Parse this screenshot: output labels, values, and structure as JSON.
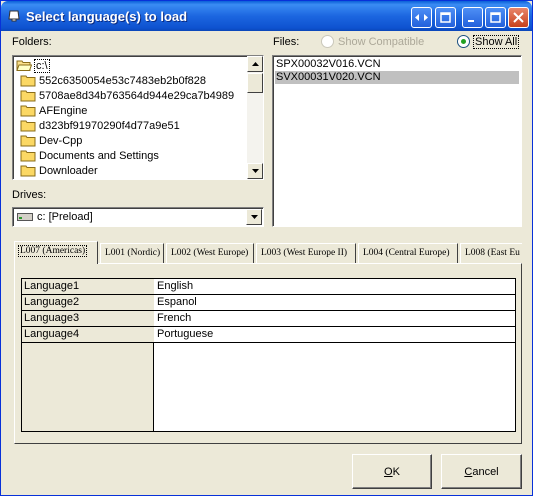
{
  "window": {
    "title": "Select language(s) to load",
    "title_icon": "bell-icon"
  },
  "folders": {
    "label": "Folders:",
    "items": [
      "c:\\",
      "552c6350054e53c7483eb2b0f828",
      "5708ae8d34b763564d944e29ca7b4989",
      "AFEngine",
      "d323bf91970290f4d77a9e51",
      "Dev-Cpp",
      "Documents and Settings",
      "Downloader"
    ]
  },
  "drives": {
    "label": "Drives:",
    "selected": "c: [Preload]"
  },
  "files": {
    "label": "Files:",
    "show_compatible": "Show Compatible",
    "show_all": "Show All",
    "items": [
      "SPX00032V016.VCN",
      "SVX00031V020.VCN"
    ]
  },
  "tabs": [
    "L007 (Americas)",
    "L001 (Nordic)",
    "L002 (West Europe)",
    "L003 (West Europe II)",
    "L004 (Central Europe)",
    "L008 (East Eu"
  ],
  "grid": {
    "rows": [
      {
        "key": "Language1",
        "value": "English"
      },
      {
        "key": "Language2",
        "value": "Espanol"
      },
      {
        "key": "Language3",
        "value": "French"
      },
      {
        "key": "Language4",
        "value": "Portuguese"
      }
    ]
  },
  "buttons": {
    "ok_accel": "O",
    "ok_rest": "K",
    "cancel_accel": "C",
    "cancel_rest": "ancel"
  },
  "colors": {
    "title_bar": "#1c66e0",
    "dialog_bg": "#ece9d8",
    "selection": "#c0c0c0"
  }
}
